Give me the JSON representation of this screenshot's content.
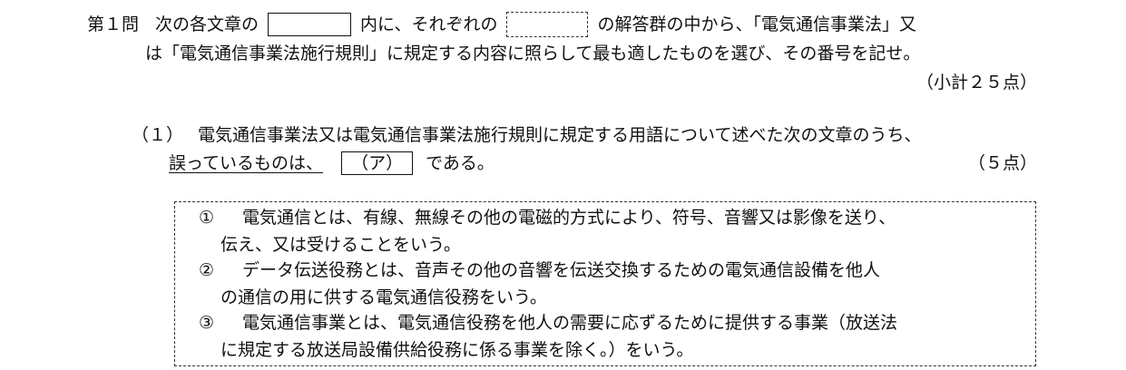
{
  "question": {
    "number_label": "第１問",
    "instruction_part1": "次の各文章の",
    "instruction_part2": "内に、それぞれの",
    "instruction_part3": "の解答群の中から、「電気通信事業法」又",
    "instruction_line2": "は「電気通信事業法施行規則」に規定する内容に照らして最も適したものを選び、その番号を記せ。",
    "subtotal": "（小計２５点）"
  },
  "subquestion": {
    "number": "（１）",
    "text_line1": "電気通信事業法又は電気通信事業法施行規則に規定する用語について述べた次の文章のうち、",
    "underlined": "誤っているものは、",
    "answer_box": "（ア）",
    "text_end": "である。",
    "points": "（５点）"
  },
  "choices": [
    {
      "number": "①",
      "line1": "電気通信とは、有線、無線その他の電磁的方式により、符号、音響又は影像を送り、",
      "line2": "伝え、又は受けることをいう。"
    },
    {
      "number": "②",
      "line1": "データ伝送役務とは、音声その他の音響を伝送交換するための電気通信設備を他人",
      "line2": "の通信の用に供する電気通信役務をいう。"
    },
    {
      "number": "③",
      "line1": "電気通信事業とは、電気通信役務を他人の需要に応ずるために提供する事業（放送法",
      "line2": "に規定する放送局設備供給役務に係る事業を除く。）をいう。"
    }
  ]
}
